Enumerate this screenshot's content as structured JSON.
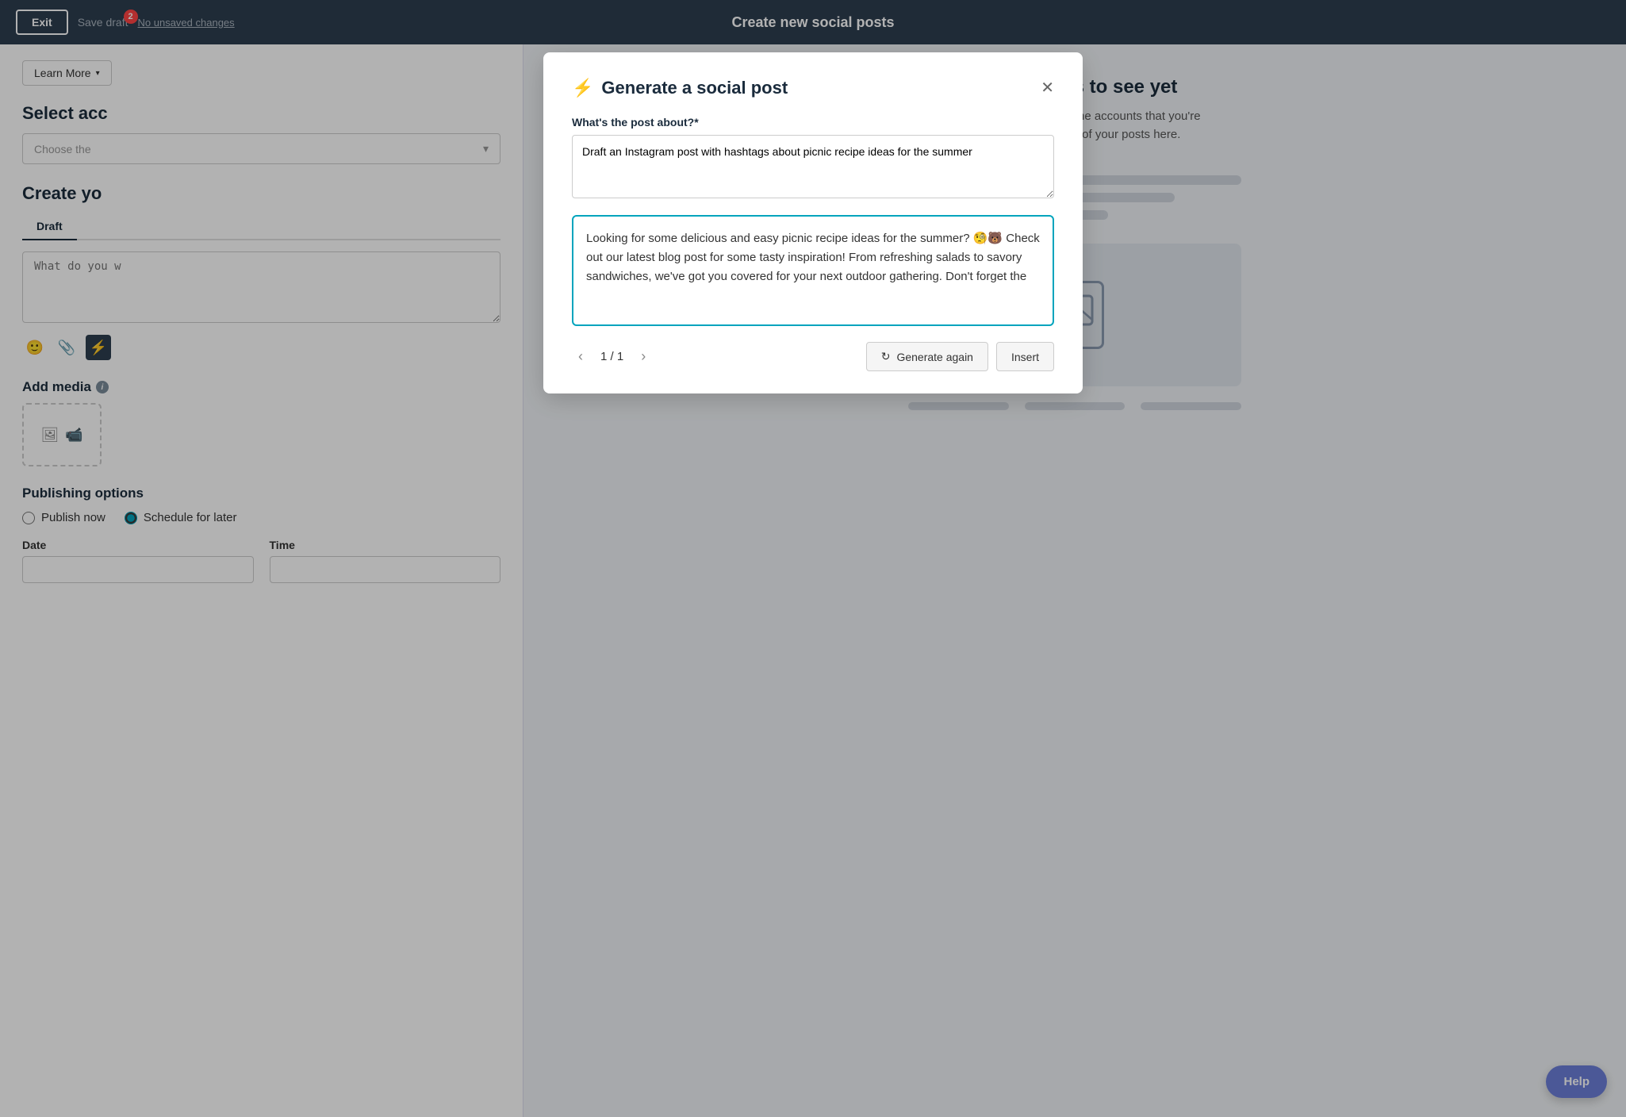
{
  "topnav": {
    "exit_label": "Exit",
    "save_draft_label": "Save draft",
    "badge_count": "2",
    "no_unsaved_label": "No unsaved changes",
    "title": "Create new social posts"
  },
  "left_panel": {
    "learn_more_label": "Learn More",
    "select_accounts_title": "Select acc",
    "choose_the_placeholder": "Choose the",
    "create_your_title": "Create yo",
    "draft_tab_label": "Draft",
    "post_placeholder": "What do you w",
    "add_media_title": "Add media",
    "publishing_title": "Publishing options",
    "publish_now_label": "Publish now",
    "schedule_later_label": "Schedule for later",
    "date_label": "Date",
    "time_label": "Time"
  },
  "right_panel": {
    "no_preview_title": "No previews to see yet",
    "no_preview_text": "sure you have selected the accounts that you're from to see previews of your posts here."
  },
  "modal": {
    "title": "Generate a social post",
    "what_about_label": "What's the post about?*",
    "prompt_value": "Draft an Instagram post with hashtags about picnic recipe ideas for the summer",
    "generated_text": "Looking for some delicious and easy picnic recipe ideas for the summer? 🧐🐻 Check out our latest blog post for some tasty inspiration! From refreshing salads to savory sandwiches, we've got you covered for your next outdoor gathering. Don't forget the",
    "pagination": "1 / 1",
    "generate_again_label": "Generate again",
    "insert_label": "Insert"
  },
  "help_btn_label": "Help"
}
